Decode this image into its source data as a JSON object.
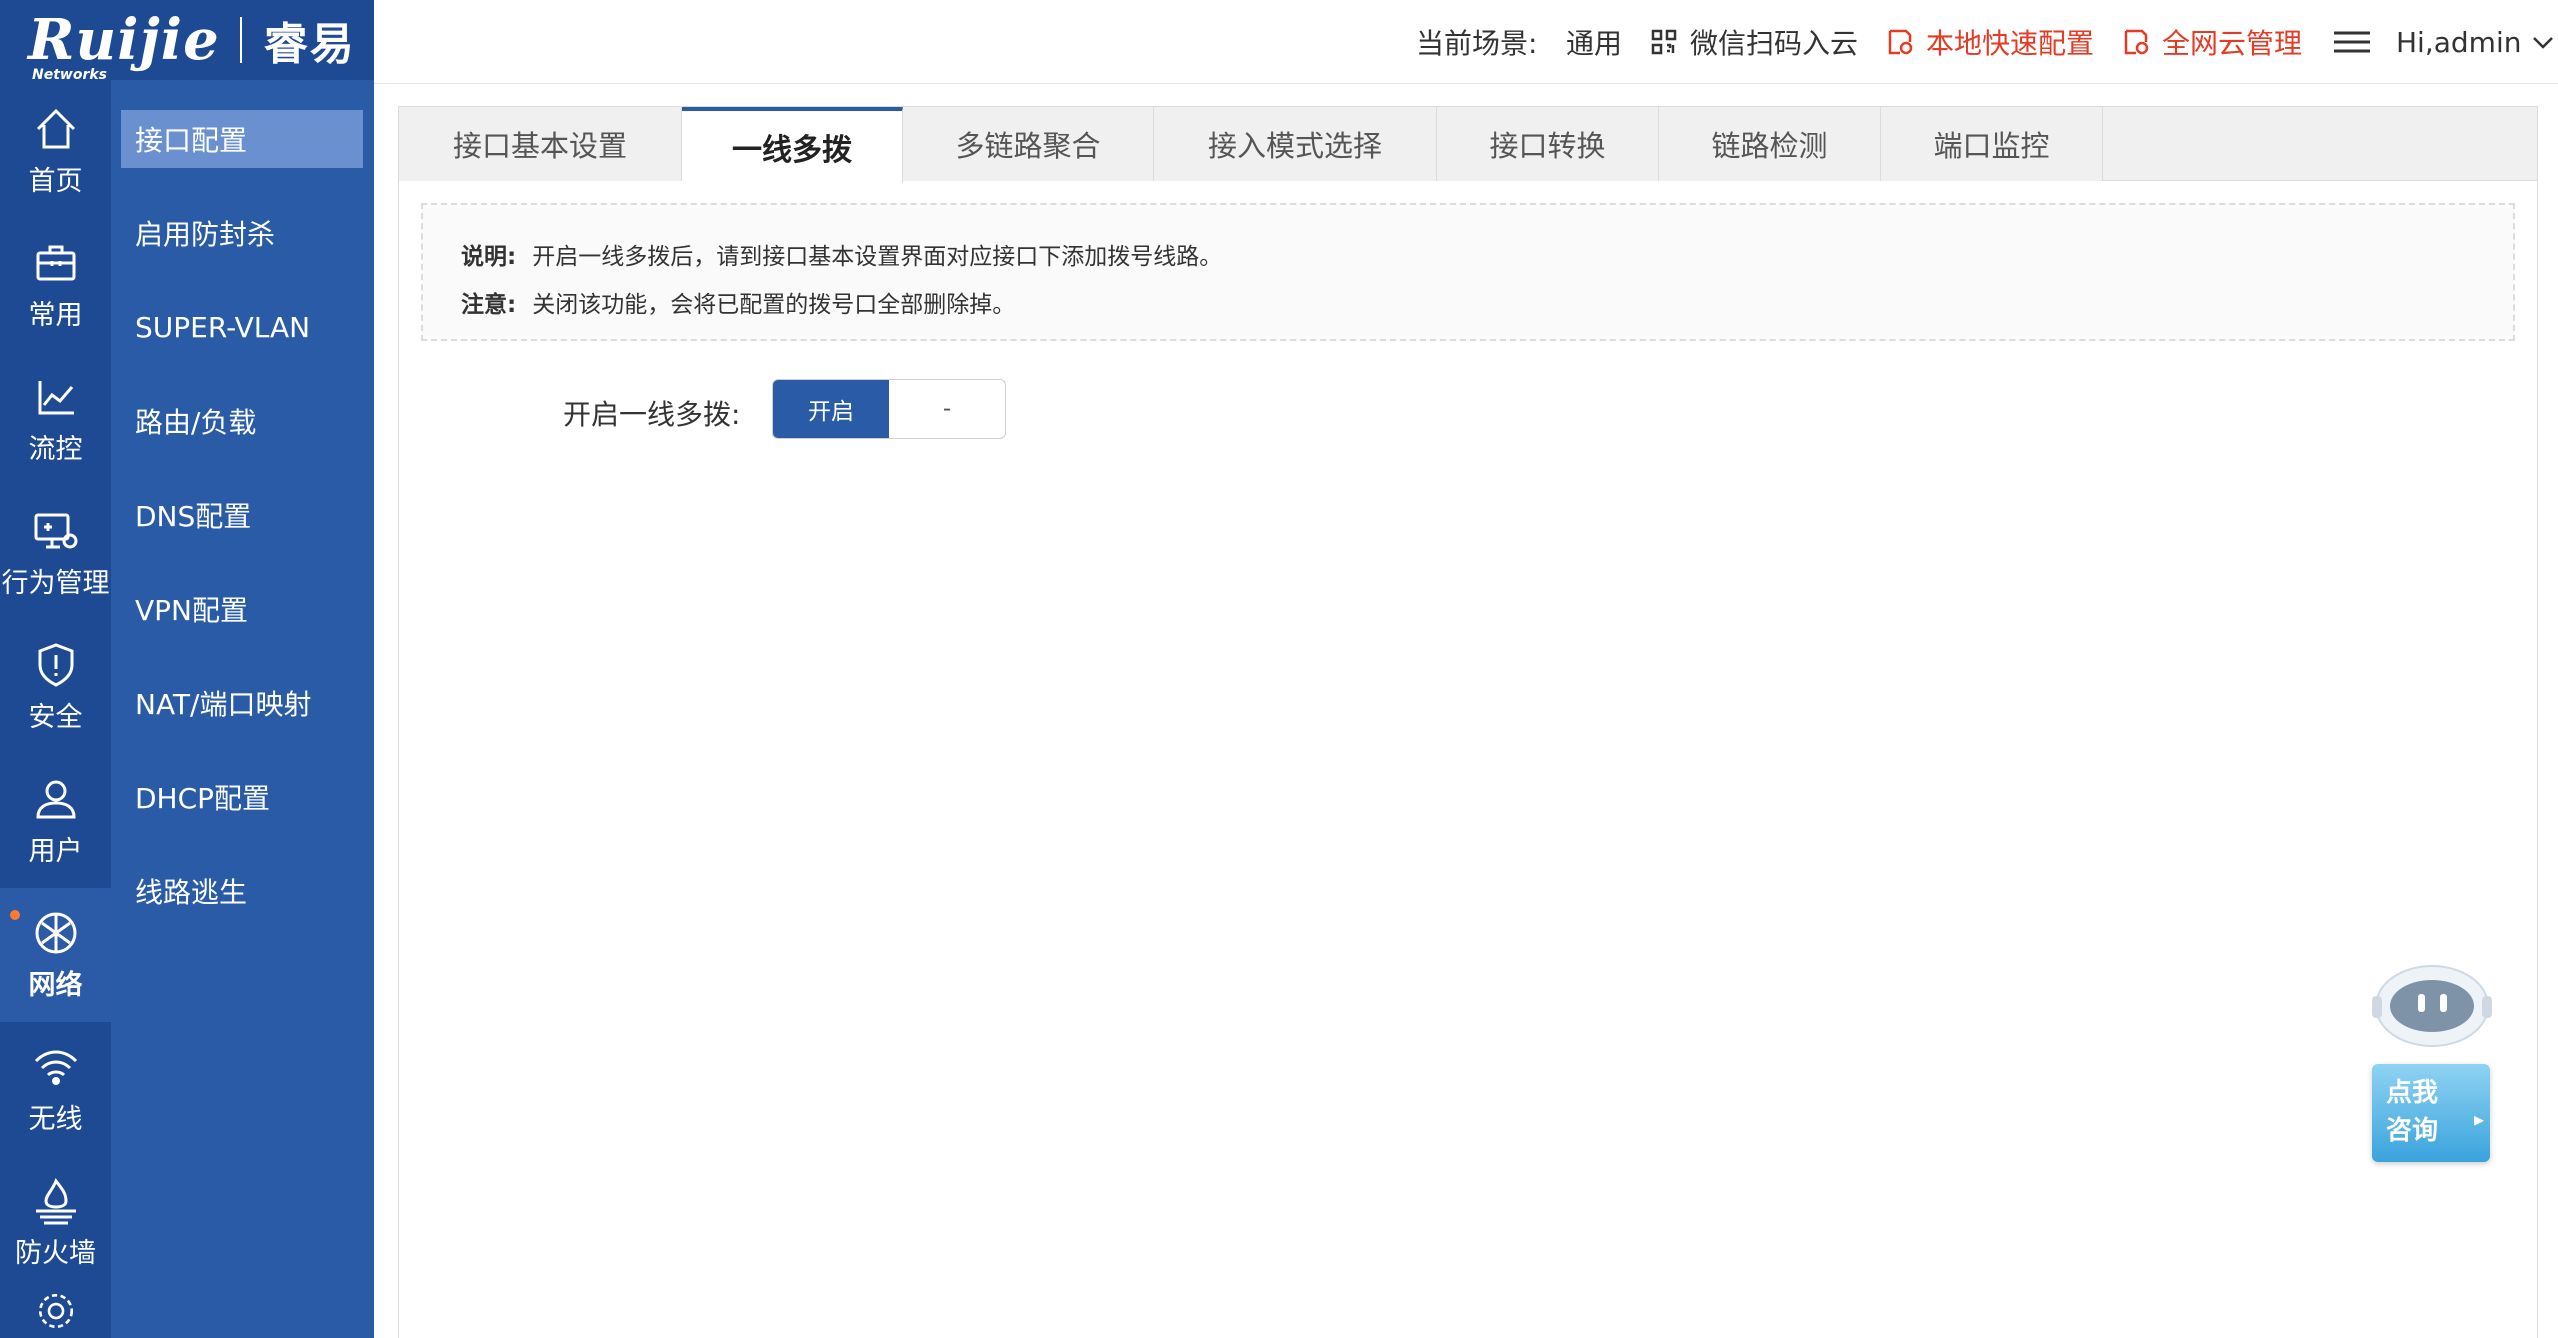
{
  "brand": {
    "name": "Ruijie",
    "sub": "Networks",
    "cn": "睿易"
  },
  "header": {
    "scene_label": "当前场景:",
    "scene_value": "通用",
    "wechat": "微信扫码入云",
    "quick_config": "本地快速配置",
    "cloud_manage": "全网云管理",
    "user": "Hi,admin"
  },
  "rail": [
    {
      "label": "首页",
      "icon": "home-icon"
    },
    {
      "label": "常用",
      "icon": "toolbox-icon"
    },
    {
      "label": "流控",
      "icon": "chart-line-icon"
    },
    {
      "label": "行为管理",
      "icon": "monitor-gear-icon"
    },
    {
      "label": "安全",
      "icon": "shield-icon"
    },
    {
      "label": "用户",
      "icon": "user-icon"
    },
    {
      "label": "网络",
      "icon": "globe-icon",
      "active": true
    },
    {
      "label": "无线",
      "icon": "wifi-icon"
    },
    {
      "label": "防火墙",
      "icon": "firewall-icon"
    }
  ],
  "submenu": [
    {
      "label": "接口配置",
      "active": true
    },
    {
      "label": "启用防封杀"
    },
    {
      "label": "SUPER-VLAN"
    },
    {
      "label": "路由/负载"
    },
    {
      "label": "DNS配置"
    },
    {
      "label": "VPN配置"
    },
    {
      "label": "NAT/端口映射"
    },
    {
      "label": "DHCP配置"
    },
    {
      "label": "线路逃生"
    }
  ],
  "tabs": [
    {
      "label": "接口基本设置"
    },
    {
      "label": "一线多拨",
      "active": true
    },
    {
      "label": "多链路聚合"
    },
    {
      "label": "接入模式选择"
    },
    {
      "label": "接口转换"
    },
    {
      "label": "链路检测"
    },
    {
      "label": "端口监控"
    }
  ],
  "notice": {
    "line1_label": "说明:",
    "line1_text": "开启一线多拨后，请到接口基本设置界面对应接口下添加拨号线路。",
    "line2_label": "注意:",
    "line2_text": "关闭该功能，会将已配置的拨号口全部删除掉。"
  },
  "form": {
    "label": "开启一线多拨:",
    "on": "开启",
    "off": "-"
  },
  "bot": {
    "line1": "点我",
    "line2": "咨询"
  },
  "colors": {
    "rail": "#1d4a92",
    "submenu": "#2a5ba7",
    "accent_red": "#e53a23"
  }
}
